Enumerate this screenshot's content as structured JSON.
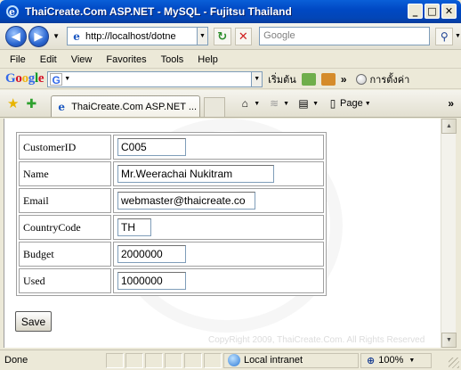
{
  "window": {
    "title": "ThaiCreate.Com ASP.NET - MySQL - Fujitsu Thailand",
    "buttons": {
      "minimize": "_",
      "maximize": "□",
      "close": "✕"
    }
  },
  "address_bar": {
    "url": "http://localhost/dotne",
    "search_placeholder": "Google"
  },
  "menu": [
    "File",
    "Edit",
    "View",
    "Favorites",
    "Tools",
    "Help"
  ],
  "google_toolbar": {
    "logo": "Google",
    "start_label": "เริ่มต้น",
    "settings_label": "การตั้งค่า"
  },
  "tab": {
    "title": "ThaiCreate.Com ASP.NET ...",
    "page_label": "Page"
  },
  "form": {
    "fields": [
      {
        "label": "CustomerID",
        "value": "C005"
      },
      {
        "label": "Name",
        "value": "Mr.Weerachai Nukitram"
      },
      {
        "label": "Email",
        "value": "webmaster@thaicreate.co"
      },
      {
        "label": "CountryCode",
        "value": "TH"
      },
      {
        "label": "Budget",
        "value": "2000000"
      },
      {
        "label": "Used",
        "value": "1000000"
      }
    ],
    "save_label": "Save"
  },
  "footer": {
    "copyright": "CopyRight 2009, ThaiCreate.Com. All Rights Reserved"
  },
  "status": {
    "text": "Done",
    "zone": "Local intranet",
    "zoom": "100%"
  },
  "colors": {
    "titlebar": "#0049c4",
    "link_blue": "#1b57c1",
    "border_gray": "#a0a0a0"
  }
}
